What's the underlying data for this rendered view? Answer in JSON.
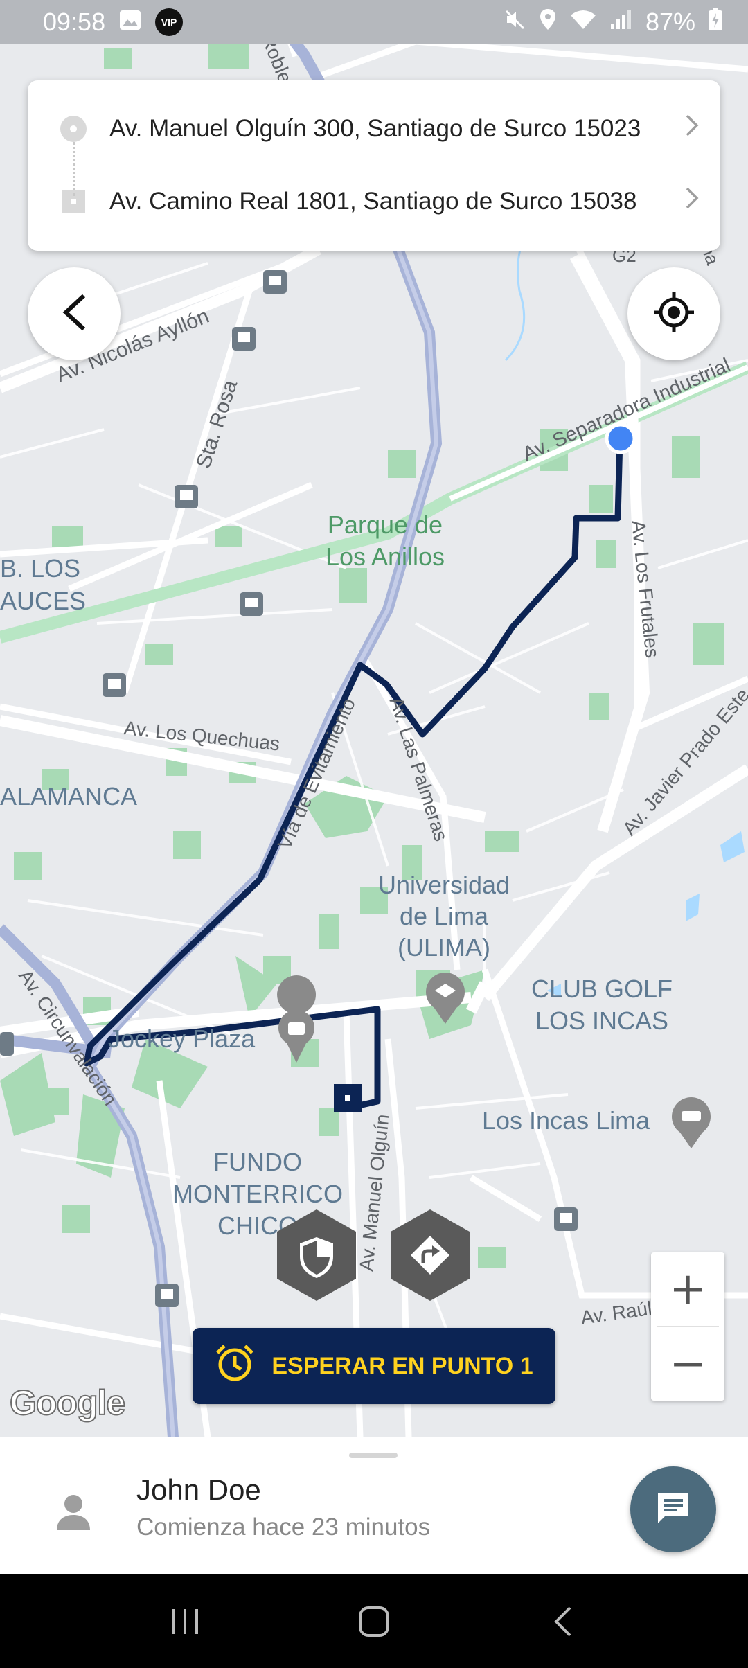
{
  "status_bar": {
    "time": "09:58",
    "battery": "87%",
    "icons": [
      "image-icon",
      "vip-app-icon",
      "mute-icon",
      "location-icon",
      "wifi-icon",
      "signal-icon",
      "battery-charging-icon"
    ],
    "vip_badge": "VIP"
  },
  "route": {
    "origin": "Av. Manuel Olguín 300, Santiago de Surco 15023",
    "destination": "Av. Camino Real 1801, Santiago de Surco 15038"
  },
  "map_labels": {
    "av_robles": "Av. Robles",
    "av_nicolas_ayllon": "Av. Nicolás Ayllón",
    "sta_rosa": "Sta. Rosa",
    "av_separadora": "Av. Separadora Industrial",
    "parque_1": "Parque de",
    "parque_2": "Los Anillos",
    "b_los_1": "B. LOS",
    "b_los_2": "AUCES",
    "av_los_frutales": "Av. Los Frutales",
    "av_los_quechuas": "Av. Los Quechuas",
    "av_las_palmeras": "Av. Las Palmeras",
    "via_evitamiento": "Vía de Evitamiento",
    "av_javier_prado": "Av. Javier Prado Este",
    "salamanca": "ALAMANCA",
    "universidad_1": "Universidad",
    "universidad_2": "de Lima",
    "universidad_3": "(ULIMA)",
    "club_golf_1": "CLUB GOLF",
    "club_golf_2": "LOS INCAS",
    "av_circunvalacion": "Av. Circunvalación",
    "jockey_plaza": "Jockey Plaza",
    "los_incas_lima": "Los Incas Lima",
    "fundo_1": "FUNDO",
    "fundo_2": "MONTERRICO",
    "fundo_3": "CHICO",
    "av_manuel_olguin": "Av. Manuel Olguín",
    "av_raul_ferrero": "Av. Raúl Ferrero",
    "g2": "G2",
    "lina": "lina"
  },
  "map_controls": {
    "zoom_in": "+",
    "zoom_out": "−",
    "google": "Google"
  },
  "actions": {
    "wait_button": "ESPERAR EN PUNTO 1"
  },
  "passenger": {
    "name": "John Doe",
    "subtitle": "Comienza hace 23 minutos"
  },
  "colors": {
    "route": "#0c2454",
    "wait_text": "#ffd21f",
    "chat": "#4c6b7d",
    "current_location": "#4285f4"
  }
}
